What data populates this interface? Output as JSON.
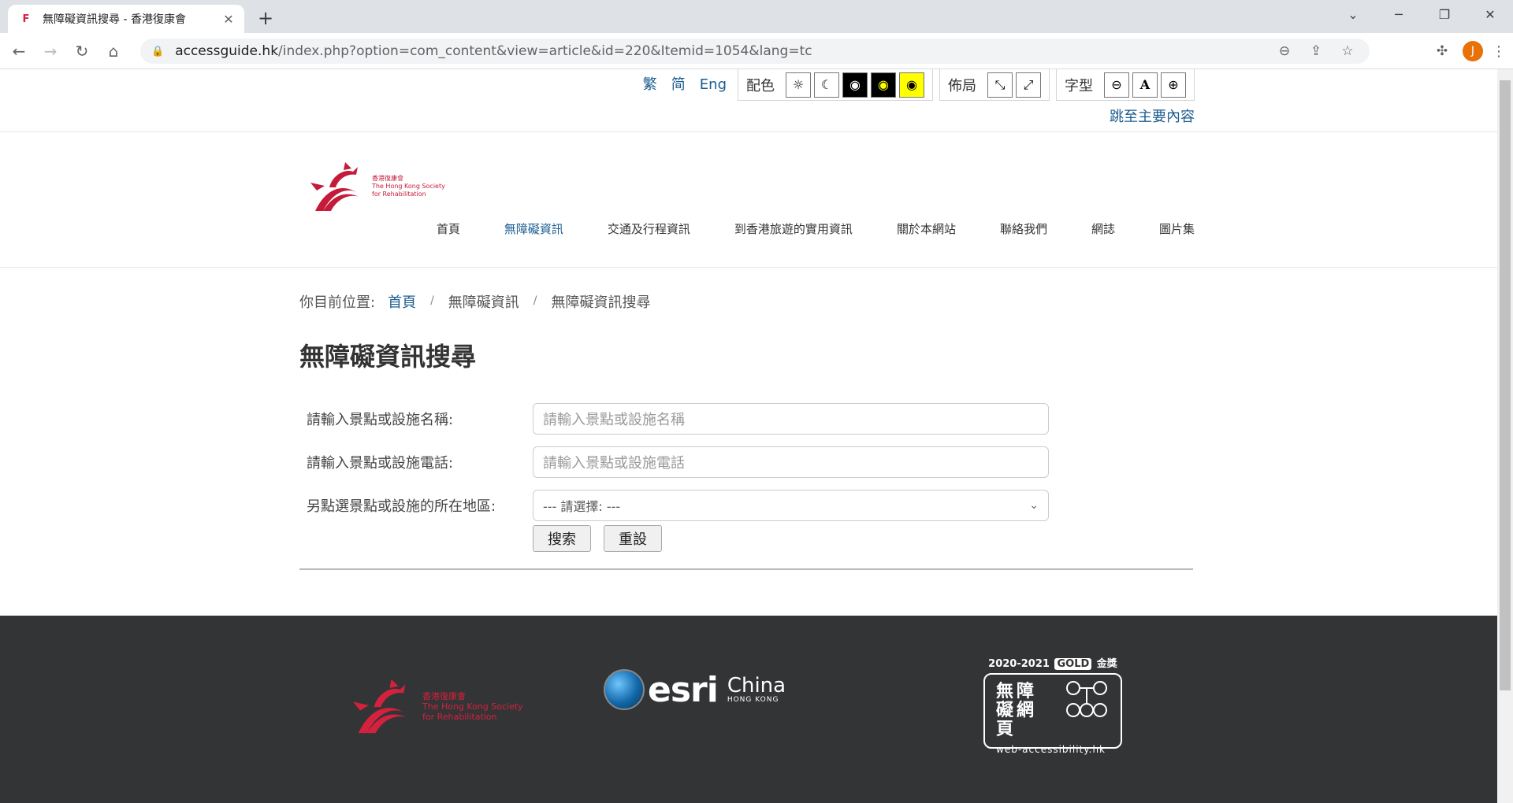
{
  "browser": {
    "tab_title": "無障礙資訊搜尋 - 香港復康會",
    "favicon": "F",
    "url_host": "accessguide.hk",
    "url_path": "/index.php?option=com_content&view=article&id=220&Itemid=1054&lang=tc",
    "avatar_letter": "J"
  },
  "accessbar": {
    "lang": [
      "繁",
      "简",
      "Eng"
    ],
    "color_label": "配色",
    "layout_label": "佈局",
    "font_label": "字型",
    "skip_link": "跳至主要內容"
  },
  "logo": {
    "line1": "香港復康會",
    "line2": "The Hong Kong Society",
    "line3": "for Rehabilitation"
  },
  "nav": [
    "首頁",
    "無障礙資訊",
    "交通及行程資訊",
    "到香港旅遊的實用資訊",
    "關於本網站",
    "聯絡我們",
    "網誌",
    "圖片集"
  ],
  "breadcrumb": {
    "prefix": "你目前位置:",
    "home": "首頁",
    "level1": "無障礙資訊",
    "level2": "無障礙資訊搜尋"
  },
  "page_title": "無障礙資訊搜尋",
  "form": {
    "name_label": "請輸入景點或設施名稱:",
    "name_placeholder": "請輸入景點或設施名稱",
    "phone_label": "請輸入景點或設施電話:",
    "phone_placeholder": "請輸入景點或設施電話",
    "district_label": "另點選景點或設施的所在地區:",
    "district_selected": "--- 請選擇: ---",
    "search_button": "搜索",
    "reset_button": "重設"
  },
  "footer": {
    "esri_word": "esri",
    "esri_china": "China",
    "esri_hk": "HONG KONG",
    "badge_year": "2020-2021",
    "badge_gold": "GOLD",
    "badge_award": "金獎",
    "badge_cn": "無障礙網頁",
    "badge_site": "web-accessibility.hk"
  },
  "colors": {
    "brand_red": "#c51a3a",
    "link_blue": "#1a5b8f",
    "footer_bg": "#333436"
  }
}
